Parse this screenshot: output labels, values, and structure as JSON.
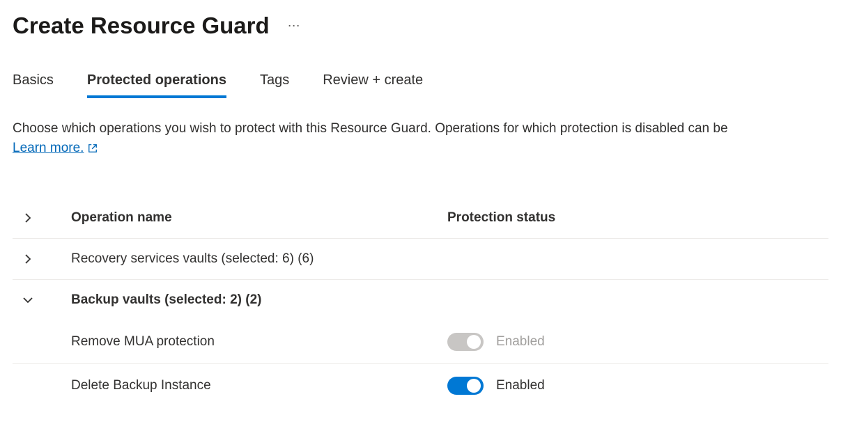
{
  "header": {
    "title": "Create Resource Guard"
  },
  "tabs": {
    "basics": "Basics",
    "protected": "Protected operations",
    "tags": "Tags",
    "review": "Review + create"
  },
  "description": "Choose which operations you wish to protect with this Resource Guard. Operations for which protection is disabled can be",
  "learn_more": "Learn more.",
  "table": {
    "col_name": "Operation name",
    "col_status": "Protection status",
    "groups": {
      "rsv": "Recovery services vaults (selected: 6) (6)",
      "backup": "Backup vaults (selected: 2) (2)"
    },
    "items": {
      "remove_mua": {
        "label": "Remove MUA protection",
        "status": "Enabled"
      },
      "delete_backup": {
        "label": "Delete Backup Instance",
        "status": "Enabled"
      }
    }
  }
}
